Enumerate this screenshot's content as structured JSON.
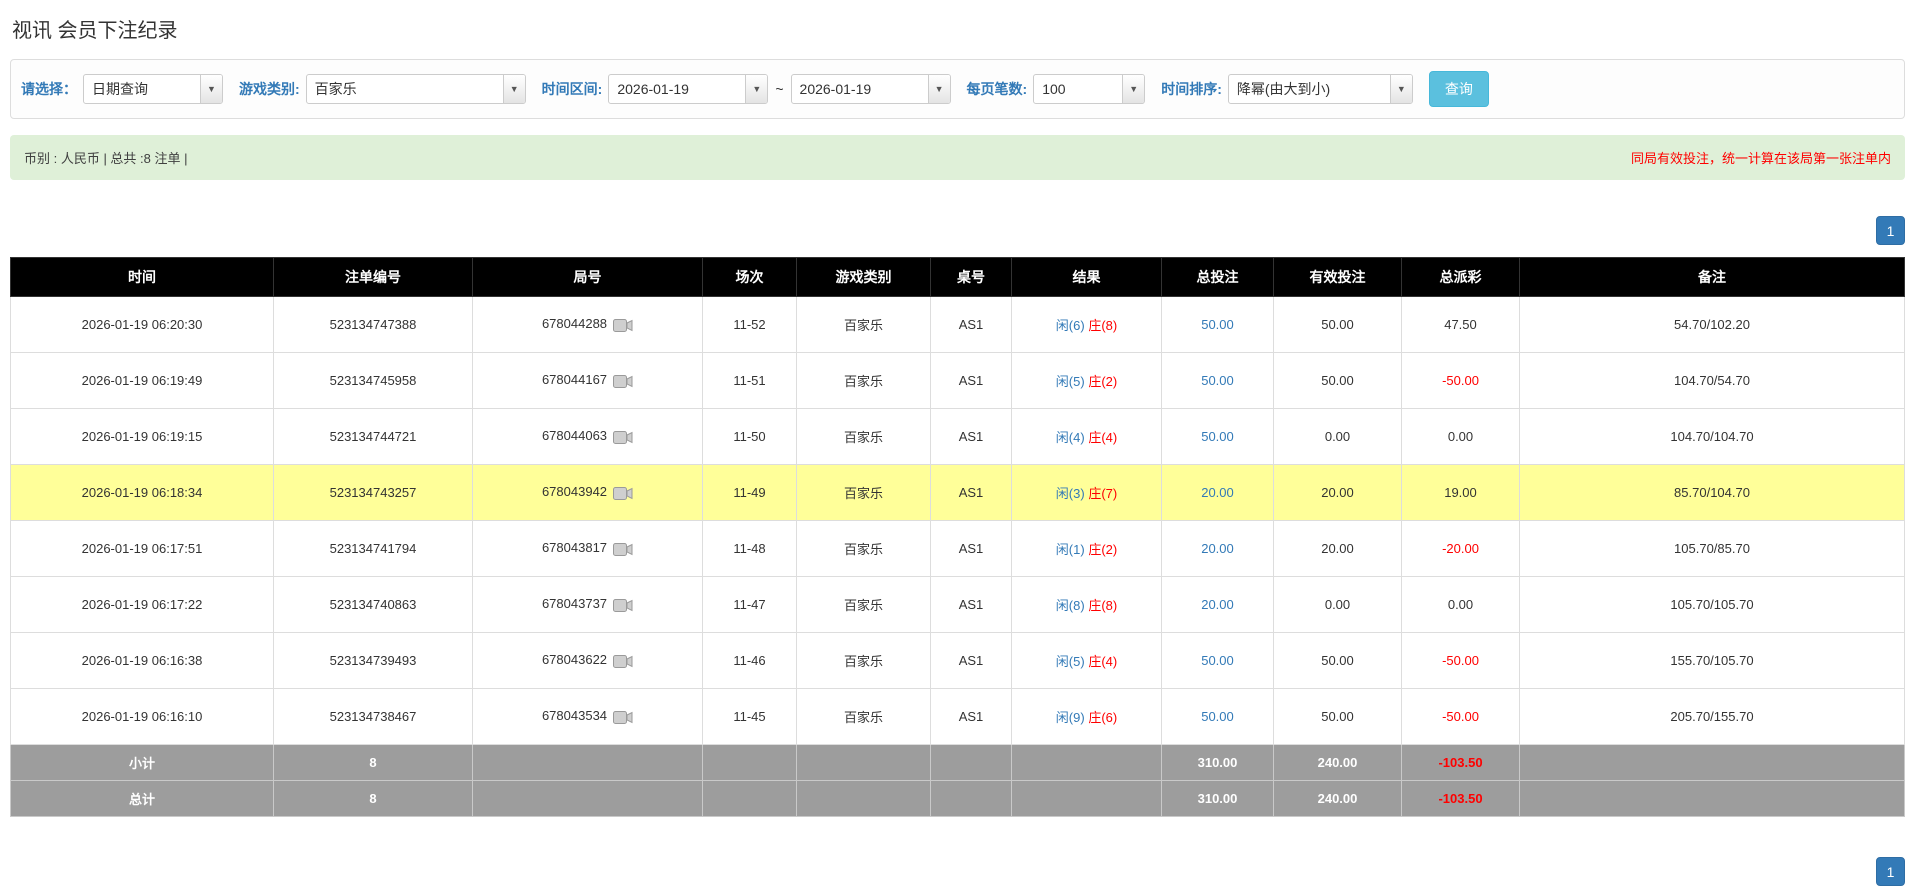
{
  "colors": {
    "accent-blue": "#337ab7",
    "link-blue": "#337ab7",
    "info-button": "#5bc0de",
    "header-bg": "#000000",
    "footer-bg": "#9d9d9d",
    "highlight-row": "#ffff99",
    "success-bg": "#dff0d8",
    "negative-red": "#ff0000"
  },
  "icons": {
    "combo_arrow": "caret-down-icon",
    "round_media": "video-icon"
  },
  "page": {
    "title": "视讯 会员下注纪录"
  },
  "filters": {
    "select_label": "请选择：",
    "select_value": "日期查询",
    "game_label": "游戏类别:",
    "game_value": "百家乐",
    "range_label": "时间区间:",
    "date_from": "2026-01-19",
    "range_separator": "~",
    "date_to": "2026-01-19",
    "page_size_label": "每页笔数:",
    "page_size_value": "100",
    "sort_label": "时间排序:",
    "sort_value": "降幂(由大到小)",
    "search_button": "查询"
  },
  "summary": {
    "left": "币别 : 人民币 | 总共 :8 注单 |",
    "right": "同局有效投注，统一计算在该局第一张注单内"
  },
  "pagination": {
    "top": "1",
    "bottom": "1"
  },
  "table": {
    "headers": [
      "时间",
      "注单编号",
      "局号",
      "场次",
      "游戏类别",
      "桌号",
      "结果",
      "总投注",
      "有效投注",
      "总派彩",
      "备注"
    ],
    "rows": [
      {
        "time": "2026-01-19 06:20:30",
        "bet_id": "523134747388",
        "round": "678044288",
        "session": "11-52",
        "game": "百家乐",
        "table_no": "AS1",
        "result_player": "闲(6)",
        "result_banker": "庄(8)",
        "total_bet": "50.00",
        "valid_bet": "50.00",
        "payout": "47.50",
        "remark": "54.70/102.20",
        "highlight": false
      },
      {
        "time": "2026-01-19 06:19:49",
        "bet_id": "523134745958",
        "round": "678044167",
        "session": "11-51",
        "game": "百家乐",
        "table_no": "AS1",
        "result_player": "闲(5)",
        "result_banker": "庄(2)",
        "total_bet": "50.00",
        "valid_bet": "50.00",
        "payout": "-50.00",
        "remark": "104.70/54.70",
        "highlight": false
      },
      {
        "time": "2026-01-19 06:19:15",
        "bet_id": "523134744721",
        "round": "678044063",
        "session": "11-50",
        "game": "百家乐",
        "table_no": "AS1",
        "result_player": "闲(4)",
        "result_banker": "庄(4)",
        "total_bet": "50.00",
        "valid_bet": "0.00",
        "payout": "0.00",
        "remark": "104.70/104.70",
        "highlight": false
      },
      {
        "time": "2026-01-19 06:18:34",
        "bet_id": "523134743257",
        "round": "678043942",
        "session": "11-49",
        "game": "百家乐",
        "table_no": "AS1",
        "result_player": "闲(3)",
        "result_banker": "庄(7)",
        "total_bet": "20.00",
        "valid_bet": "20.00",
        "payout": "19.00",
        "remark": "85.70/104.70",
        "highlight": true
      },
      {
        "time": "2026-01-19 06:17:51",
        "bet_id": "523134741794",
        "round": "678043817",
        "session": "11-48",
        "game": "百家乐",
        "table_no": "AS1",
        "result_player": "闲(1)",
        "result_banker": "庄(2)",
        "total_bet": "20.00",
        "valid_bet": "20.00",
        "payout": "-20.00",
        "remark": "105.70/85.70",
        "highlight": false
      },
      {
        "time": "2026-01-19 06:17:22",
        "bet_id": "523134740863",
        "round": "678043737",
        "session": "11-47",
        "game": "百家乐",
        "table_no": "AS1",
        "result_player": "闲(8)",
        "result_banker": "庄(8)",
        "total_bet": "20.00",
        "valid_bet": "0.00",
        "payout": "0.00",
        "remark": "105.70/105.70",
        "highlight": false
      },
      {
        "time": "2026-01-19 06:16:38",
        "bet_id": "523134739493",
        "round": "678043622",
        "session": "11-46",
        "game": "百家乐",
        "table_no": "AS1",
        "result_player": "闲(5)",
        "result_banker": "庄(4)",
        "total_bet": "50.00",
        "valid_bet": "50.00",
        "payout": "-50.00",
        "remark": "155.70/105.70",
        "highlight": false
      },
      {
        "time": "2026-01-19 06:16:10",
        "bet_id": "523134738467",
        "round": "678043534",
        "session": "11-45",
        "game": "百家乐",
        "table_no": "AS1",
        "result_player": "闲(9)",
        "result_banker": "庄(6)",
        "total_bet": "50.00",
        "valid_bet": "50.00",
        "payout": "-50.00",
        "remark": "205.70/155.70",
        "highlight": false
      }
    ],
    "subtotal": {
      "label": "小计",
      "count": "8",
      "total_bet": "310.00",
      "valid_bet": "240.00",
      "payout": "-103.50"
    },
    "total": {
      "label": "总计",
      "count": "8",
      "total_bet": "310.00",
      "valid_bet": "240.00",
      "payout": "-103.50"
    }
  }
}
